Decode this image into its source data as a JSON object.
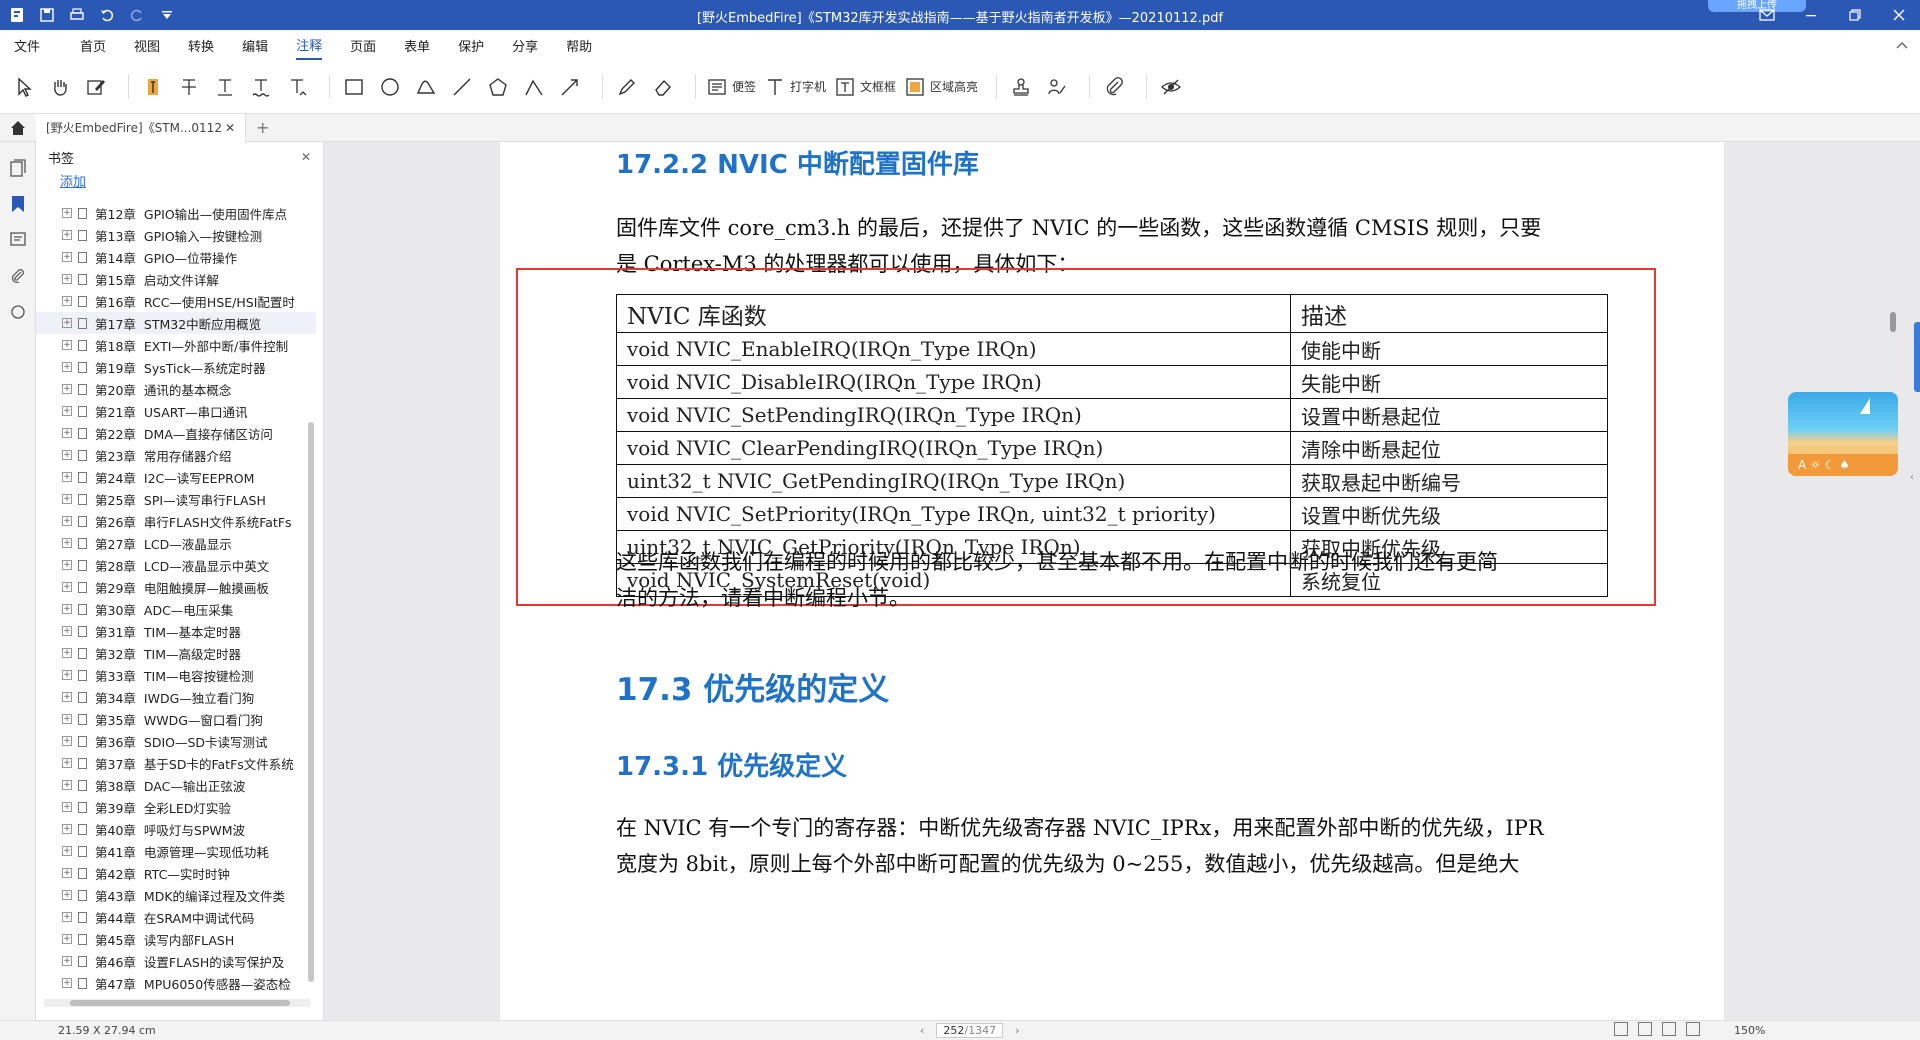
{
  "window": {
    "title": "[野火EmbedFire]《STM32库开发实战指南——基于野火指南者开发板》—20210112.pdf",
    "cloud_button": "拖拽上传"
  },
  "menu": {
    "items": [
      "文件",
      "首页",
      "视图",
      "转换",
      "编辑",
      "注释",
      "页面",
      "表单",
      "保护",
      "分享",
      "帮助"
    ],
    "active": "注释"
  },
  "toolbar": {
    "sticky_note": "便签",
    "typewriter": "打字机",
    "textbox": "文框框",
    "area_highlight": "区域高亮"
  },
  "tab": {
    "label": "[野火EmbedFire]《STM...0112"
  },
  "bookmarks": {
    "title": "书签",
    "add_label": "添加",
    "items": [
      {
        "ch": "第12章",
        "text": "GPIO输出—使用固件库点"
      },
      {
        "ch": "第13章",
        "text": "GPIO输入—按键检测"
      },
      {
        "ch": "第14章",
        "text": "GPIO—位带操作"
      },
      {
        "ch": "第15章",
        "text": "启动文件详解"
      },
      {
        "ch": "第16章",
        "text": "RCC—使用HSE/HSI配置时"
      },
      {
        "ch": "第17章",
        "text": "STM32中断应用概览"
      },
      {
        "ch": "第18章",
        "text": "EXTI—外部中断/事件控制"
      },
      {
        "ch": "第19章",
        "text": "SysTick—系统定时器"
      },
      {
        "ch": "第20章",
        "text": "通讯的基本概念"
      },
      {
        "ch": "第21章",
        "text": "USART—串口通讯"
      },
      {
        "ch": "第22章",
        "text": "DMA—直接存储区访问"
      },
      {
        "ch": "第23章",
        "text": "常用存储器介绍"
      },
      {
        "ch": "第24章",
        "text": "I2C—读写EEPROM"
      },
      {
        "ch": "第25章",
        "text": "SPI—读写串行FLASH"
      },
      {
        "ch": "第26章",
        "text": "串行FLASH文件系统FatFs"
      },
      {
        "ch": "第27章",
        "text": "LCD—液晶显示"
      },
      {
        "ch": "第28章",
        "text": "LCD—液晶显示中英文"
      },
      {
        "ch": "第29章",
        "text": "电阻触摸屏—触摸画板"
      },
      {
        "ch": "第30章",
        "text": "ADC—电压采集"
      },
      {
        "ch": "第31章",
        "text": "TIM—基本定时器"
      },
      {
        "ch": "第32章",
        "text": "TIM—高级定时器"
      },
      {
        "ch": "第33章",
        "text": "TIM—电容按键检测"
      },
      {
        "ch": "第34章",
        "text": "IWDG—独立看门狗"
      },
      {
        "ch": "第35章",
        "text": "WWDG—窗口看门狗"
      },
      {
        "ch": "第36章",
        "text": "SDIO—SD卡读写测试"
      },
      {
        "ch": "第37章",
        "text": "基于SD卡的FatFs文件系统"
      },
      {
        "ch": "第38章",
        "text": "DAC—输出正弦波"
      },
      {
        "ch": "第39章",
        "text": "全彩LED灯实验"
      },
      {
        "ch": "第40章",
        "text": "呼吸灯与SPWM波"
      },
      {
        "ch": "第41章",
        "text": "电源管理—实现低功耗"
      },
      {
        "ch": "第42章",
        "text": "RTC—实时时钟"
      },
      {
        "ch": "第43章",
        "text": "MDK的编译过程及文件类"
      },
      {
        "ch": "第44章",
        "text": "在SRAM中调试代码"
      },
      {
        "ch": "第45章",
        "text": "读写内部FLASH"
      },
      {
        "ch": "第46章",
        "text": "设置FLASH的读写保护及"
      },
      {
        "ch": "第47章",
        "text": "MPU6050传感器—姿态检"
      }
    ],
    "selected_index": 5
  },
  "document": {
    "heading_2_2": "17.2.2 NVIC 中断配置固件库",
    "para1_line1": "固件库文件 core_cm3.h 的最后，还提供了 NVIC 的一些函数，这些函数遵循 CMSIS 规则，只要",
    "para1_line2": "是 Cortex-M3 的处理器都可以使用，具体如下：",
    "table": {
      "headers": [
        "NVIC 库函数",
        "描述"
      ],
      "rows": [
        [
          "void NVIC_EnableIRQ(IRQn_Type IRQn)",
          "使能中断"
        ],
        [
          "void NVIC_DisableIRQ(IRQn_Type IRQn)",
          "失能中断"
        ],
        [
          "void NVIC_SetPendingIRQ(IRQn_Type IRQn)",
          "设置中断悬起位"
        ],
        [
          "void NVIC_ClearPendingIRQ(IRQn_Type IRQn)",
          "清除中断悬起位"
        ],
        [
          "uint32_t NVIC_GetPendingIRQ(IRQn_Type IRQn)",
          "获取悬起中断编号"
        ],
        [
          "void NVIC_SetPriority(IRQn_Type IRQn, uint32_t priority)",
          "设置中断优先级"
        ],
        [
          "uint32_t NVIC_GetPriority(IRQn_Type IRQn)",
          "获取中断优先级"
        ],
        [
          "void NVIC_SystemReset(void)",
          "系统复位"
        ]
      ]
    },
    "para2_line1": "这些库函数我们在编程的时候用的都比较少，甚至基本都不用。在配置中断的时候我们还有更简",
    "para2_line2": "洁的方法，请看中断编程小节。",
    "heading_3": "17.3 优先级的定义",
    "heading_3_1": "17.3.1 优先级定义",
    "para3_line1": "在 NVIC 有一个专门的寄存器：中断优先级寄存器 NVIC_IPRx，用来配置外部中断的优先级，IPR",
    "para3_line2": "宽度为 8bit，原则上每个外部中断可配置的优先级为 0~255，数值越小，优先级越高。但是绝大"
  },
  "status": {
    "dimensions": "21.59 X 27.94 cm",
    "page": "252",
    "total": "/1347",
    "zoom": "150%"
  },
  "colors": {
    "title_bar": "#2b58b5",
    "heading_blue": "#1e73c8",
    "highlight_red": "#e53935"
  }
}
